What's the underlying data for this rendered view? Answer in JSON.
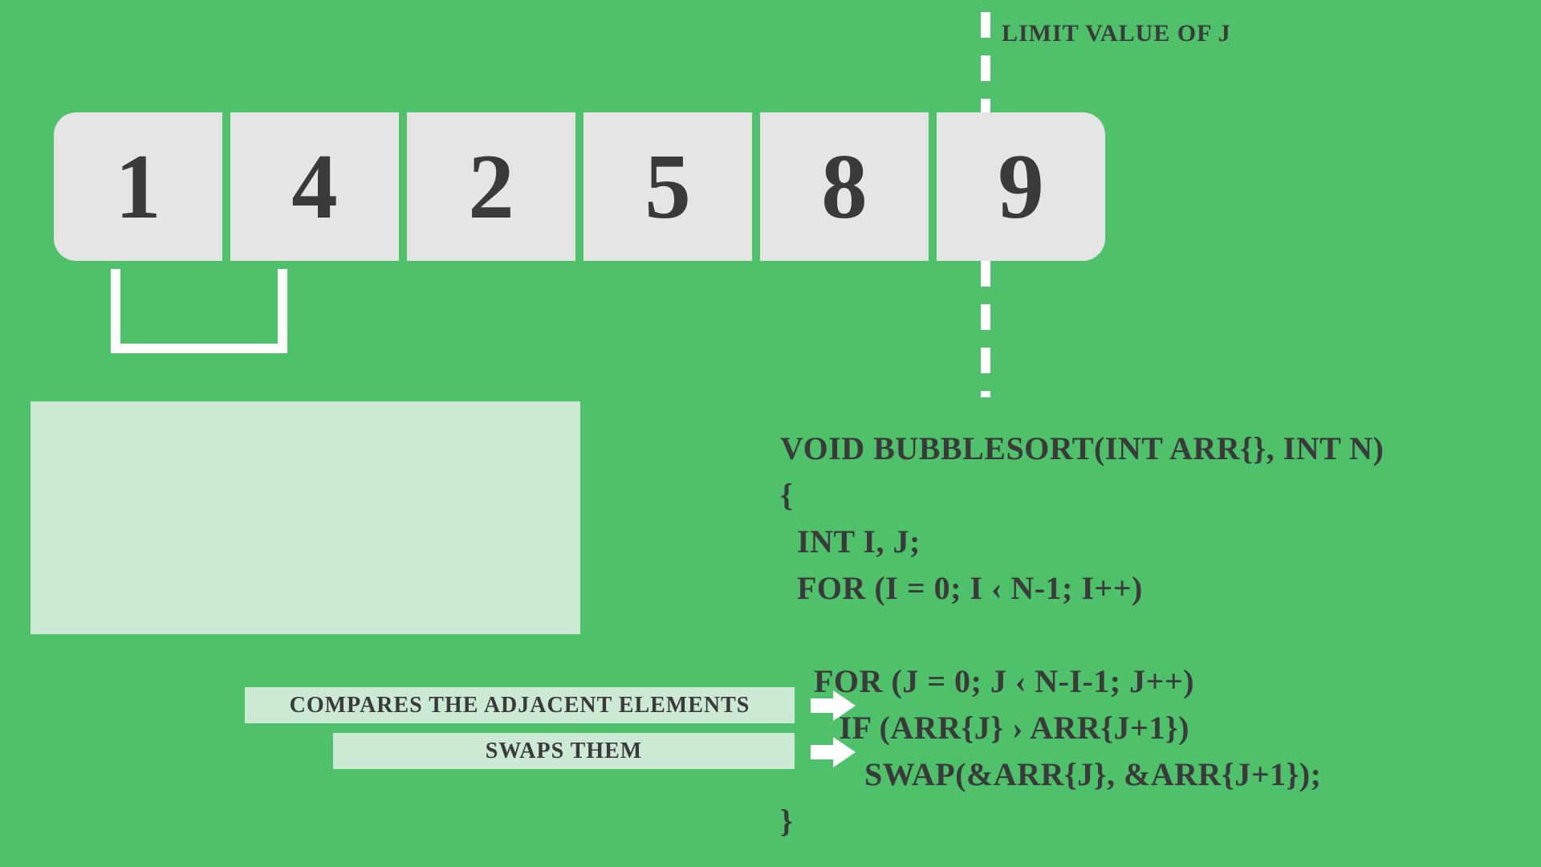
{
  "limit_label": "LIMIT VALUE OF J",
  "array": [
    "1",
    "4",
    "2",
    "5",
    "8",
    "9"
  ],
  "placeholder": "",
  "annotations": {
    "compare": "COMPARES THE ADJACENT ELEMENTS",
    "swap": "SWAPS THEM"
  },
  "code": {
    "l0": "VOID BUBBLESORT(INT ARR{}, INT N)",
    "l1": "{",
    "l2": "  INT I, J;",
    "l3": "  FOR (I = 0; I ‹ N-1; I++)",
    "l4": "",
    "l5": "    FOR (J = 0; J ‹ N-I-1; J++)",
    "l6": "       IF (ARR{J} › ARR{J+1})",
    "l7": "          SWAP(&ARR{J}, &ARR{J+1});",
    "l8": "}"
  }
}
